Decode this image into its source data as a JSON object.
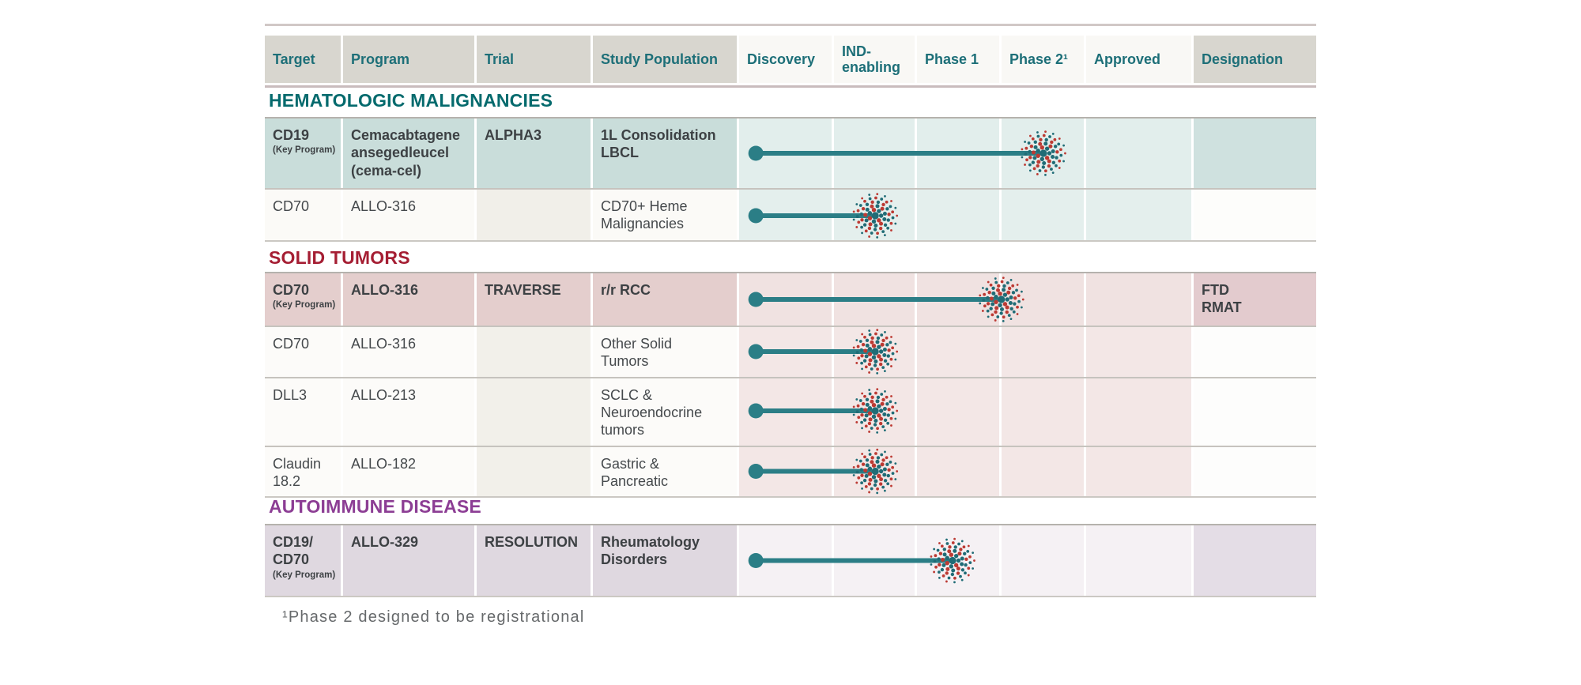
{
  "header": {
    "columns": [
      {
        "label": "Target",
        "group": "info"
      },
      {
        "label": "Program",
        "group": "info"
      },
      {
        "label": "Trial",
        "group": "info"
      },
      {
        "label": "Study Population",
        "group": "info"
      },
      {
        "label": "Discovery",
        "group": "phase"
      },
      {
        "label": "IND-enabling",
        "group": "phase"
      },
      {
        "label": "Phase 1",
        "group": "phase"
      },
      {
        "label": "Phase 2¹",
        "group": "phase"
      },
      {
        "label": "Approved",
        "group": "phase"
      },
      {
        "label": "Designation",
        "group": "info"
      }
    ]
  },
  "key_program_label": "(Key Program)",
  "footnote": "¹Phase 2 designed to be registrational",
  "colors": {
    "header_text": "#1d6f78",
    "bar": "#2b7e86",
    "burst_red": "#bc3a33",
    "burst_teal": "#206c76",
    "header_info_bg": "#d8d6cf",
    "header_phase_bg": "#f9f8f5"
  },
  "sections": [
    {
      "title": "HEMATOLOGIC MALIGNANCIES",
      "color": "#046a6d",
      "theme": "teal",
      "rows": [
        {
          "target": "CD19",
          "key_program": true,
          "program": "Cemacabtagene ansegedleucel (cema-cel)",
          "trial": "ALPHA3",
          "study_population": "1L Consolidation LBCL",
          "designation": "",
          "stage_reached": "Phase 2",
          "bar": {
            "start": 0.037,
            "end": 0.673
          }
        },
        {
          "target": "CD70",
          "key_program": false,
          "program": "ALLO-316",
          "trial": "",
          "study_population": "CD70+ Heme Malignancies",
          "designation": "",
          "stage_reached": "IND-enabling",
          "bar": {
            "start": 0.037,
            "end": 0.301
          }
        }
      ]
    },
    {
      "title": "SOLID TUMORS",
      "color": "#a51e33",
      "theme": "red",
      "rows": [
        {
          "target": "CD70",
          "key_program": true,
          "program": "ALLO-316",
          "trial": "TRAVERSE",
          "study_population": "r/r RCC",
          "designation": "FTD\nRMAT",
          "stage_reached": "End of Phase 1",
          "bar": {
            "start": 0.037,
            "end": 0.58
          }
        },
        {
          "target": "CD70",
          "key_program": false,
          "program": "ALLO-316",
          "trial": "",
          "study_population": "Other Solid\nTumors",
          "designation": "",
          "stage_reached": "IND-enabling",
          "bar": {
            "start": 0.037,
            "end": 0.301
          }
        },
        {
          "target": "DLL3",
          "key_program": false,
          "program": "ALLO-213",
          "trial": "",
          "study_population": "SCLC &\nNeuroendocrine tumors",
          "designation": "",
          "stage_reached": "IND-enabling",
          "bar": {
            "start": 0.037,
            "end": 0.301
          }
        },
        {
          "target": "Claudin 18.2",
          "key_program": false,
          "program": "ALLO-182",
          "trial": "",
          "study_population": "Gastric & Pancreatic",
          "designation": "",
          "stage_reached": "IND-enabling",
          "bar": {
            "start": 0.037,
            "end": 0.301
          }
        }
      ]
    },
    {
      "title": "AUTOIMMUNE DISEASE",
      "color": "#8c3d94",
      "theme": "purple",
      "rows": [
        {
          "target": "CD19/\nCD70",
          "key_program": true,
          "program": "ALLO-329",
          "trial": "RESOLUTION",
          "study_population": "Rheumatology Disorders",
          "designation": "",
          "stage_reached": "Phase 1",
          "bar": {
            "start": 0.037,
            "end": 0.472
          }
        }
      ]
    }
  ],
  "chart_data": {
    "type": "table",
    "title": "Clinical pipeline by stage",
    "stage_columns": [
      "Discovery",
      "IND-enabling",
      "Phase 1",
      "Phase 2¹",
      "Approved"
    ],
    "rows": [
      {
        "section": "HEMATOLOGIC MALIGNANCIES",
        "target": "CD19",
        "program": "Cemacabtagene ansegedleucel (cema-cel)",
        "trial": "ALPHA3",
        "study_population": "1L Consolidation LBCL",
        "stage_reached": "Phase 2",
        "progress": 0.673,
        "designation": ""
      },
      {
        "section": "HEMATOLOGIC MALIGNANCIES",
        "target": "CD70",
        "program": "ALLO-316",
        "trial": "",
        "study_population": "CD70+ Heme Malignancies",
        "stage_reached": "IND-enabling",
        "progress": 0.301,
        "designation": ""
      },
      {
        "section": "SOLID TUMORS",
        "target": "CD70",
        "program": "ALLO-316",
        "trial": "TRAVERSE",
        "study_population": "r/r RCC",
        "stage_reached": "End of Phase 1",
        "progress": 0.58,
        "designation": "FTD RMAT"
      },
      {
        "section": "SOLID TUMORS",
        "target": "CD70",
        "program": "ALLO-316",
        "trial": "",
        "study_population": "Other Solid Tumors",
        "stage_reached": "IND-enabling",
        "progress": 0.301,
        "designation": ""
      },
      {
        "section": "SOLID TUMORS",
        "target": "DLL3",
        "program": "ALLO-213",
        "trial": "",
        "study_population": "SCLC & Neuroendocrine tumors",
        "stage_reached": "IND-enabling",
        "progress": 0.301,
        "designation": ""
      },
      {
        "section": "SOLID TUMORS",
        "target": "Claudin 18.2",
        "program": "ALLO-182",
        "trial": "",
        "study_population": "Gastric & Pancreatic",
        "stage_reached": "IND-enabling",
        "progress": 0.301,
        "designation": ""
      },
      {
        "section": "AUTOIMMUNE DISEASE",
        "target": "CD19/CD70",
        "program": "ALLO-329",
        "trial": "RESOLUTION",
        "study_population": "Rheumatology Disorders",
        "stage_reached": "Phase 1",
        "progress": 0.472,
        "designation": ""
      }
    ],
    "footnote": "¹Phase 2 designed to be registrational"
  }
}
